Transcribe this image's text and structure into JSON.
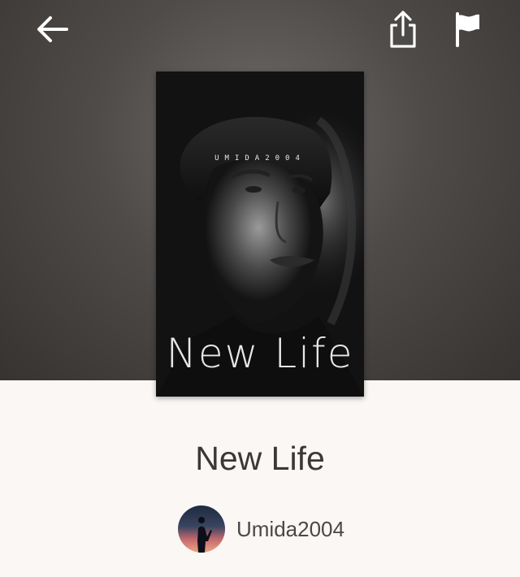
{
  "header": {
    "icons": {
      "back": "arrow-left-icon",
      "share": "share-icon",
      "report": "flag-icon"
    }
  },
  "cover": {
    "author_text": "UMIDA2004",
    "title_text": "New Life"
  },
  "story": {
    "title": "New Life",
    "author": "Umida2004"
  },
  "colors": {
    "hero_background": "#4e4b49",
    "page_background": "#faf7f4",
    "title_text": "#3a3836",
    "author_text": "#4a4846"
  }
}
